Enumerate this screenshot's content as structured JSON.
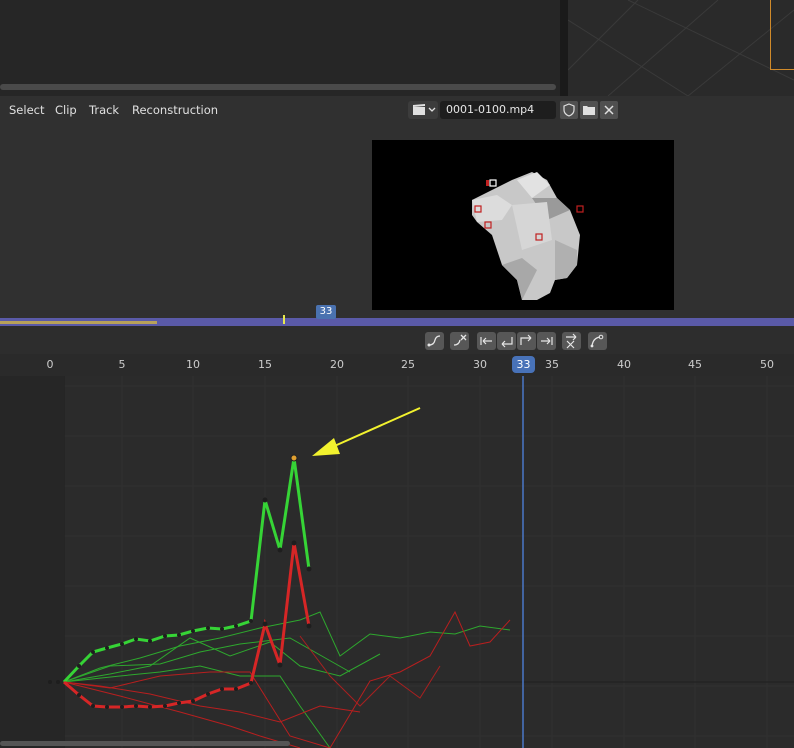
{
  "header": {
    "menus": [
      "Select",
      "Clip",
      "Track",
      "Reconstruction"
    ],
    "clip_name": "0001-0100.mp4"
  },
  "timeline": {
    "current_frame": "33"
  },
  "ruler": {
    "ticks": [
      "0",
      "5",
      "10",
      "15",
      "20",
      "25",
      "30",
      "35",
      "40",
      "45",
      "50"
    ],
    "current_frame": "33"
  },
  "colors": {
    "accent": "#4872b8",
    "curve_green": "#36d436",
    "curve_red": "#d62626",
    "annotation_arrow": "#f2f22e"
  },
  "tool_icons": [
    "filter-tracks-icon",
    "delete-curve-icon",
    "jump-start-icon",
    "clear-path-up-icon",
    "clear-path-remaining-icon",
    "jump-end-icon",
    "delete-knot-icon",
    "view-frame-icon"
  ]
}
